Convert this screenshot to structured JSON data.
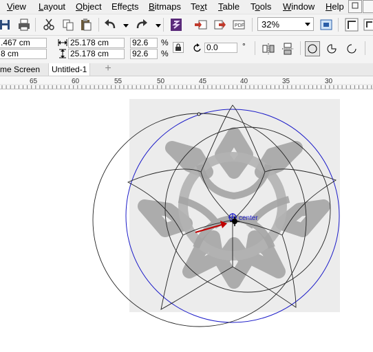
{
  "menu": {
    "items": [
      {
        "pre": "",
        "u": "V",
        "post": "iew"
      },
      {
        "pre": "",
        "u": "L",
        "post": "ayout"
      },
      {
        "pre": "",
        "u": "O",
        "post": "bject"
      },
      {
        "pre": "Effe",
        "u": "c",
        "post": "ts"
      },
      {
        "pre": "",
        "u": "B",
        "post": "itmaps"
      },
      {
        "pre": "Te",
        "u": "x",
        "post": "t"
      },
      {
        "pre": "",
        "u": "T",
        "post": "able"
      },
      {
        "pre": "T",
        "u": "o",
        "post": "ols"
      },
      {
        "pre": "",
        "u": "W",
        "post": "indow"
      },
      {
        "pre": "",
        "u": "H",
        "post": "elp"
      }
    ]
  },
  "toolbar": {
    "zoom": "32%"
  },
  "properties": {
    "x_value": ".467 cm",
    "y_value": "8 cm",
    "width_value": "25.178 cm",
    "height_value": "25.178 cm",
    "scale_x": "92.6",
    "scale_y": "92.6",
    "percent_x": "%",
    "percent_y": "%",
    "rotation": "0.0",
    "degree_symbol": "°"
  },
  "tabs": {
    "welcome": "me Screen",
    "document": "Untitled-1",
    "add": "+"
  },
  "ruler": {
    "ticks": [
      "65",
      "60",
      "55",
      "50",
      "45",
      "40",
      "35",
      "30"
    ]
  },
  "canvas": {
    "center_label": "center",
    "colors": {
      "selection_circle": "#1b1bc8",
      "arrow": "#c00000",
      "ornament": "#a9a9a9"
    }
  }
}
